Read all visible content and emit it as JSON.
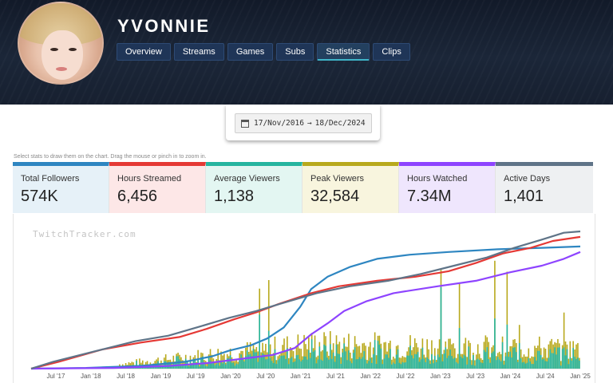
{
  "channel": {
    "name": "YVONNIE"
  },
  "tabs": [
    {
      "label": "Overview"
    },
    {
      "label": "Streams"
    },
    {
      "label": "Games"
    },
    {
      "label": "Subs"
    },
    {
      "label": "Statistics",
      "active": true
    },
    {
      "label": "Clips"
    }
  ],
  "date_range": {
    "start": "17/Nov/2016",
    "arrow": "→",
    "end": "18/Dec/2024"
  },
  "hint": "Select stats to draw them on the chart. Drag the mouse or pinch in to zoom in.",
  "stats": [
    {
      "label": "Total Followers",
      "value": "574K",
      "color": "#2e86c1",
      "bg": "#e6f1f8"
    },
    {
      "label": "Hours Streamed",
      "value": "6,456",
      "color": "#e53935",
      "bg": "#fde7e7"
    },
    {
      "label": "Average Viewers",
      "value": "1,138",
      "color": "#26b5a0",
      "bg": "#e3f6f2"
    },
    {
      "label": "Peak Viewers",
      "value": "32,584",
      "color": "#b8a91d",
      "bg": "#f8f5de"
    },
    {
      "label": "Hours Watched",
      "value": "7.34M",
      "color": "#8e44ff",
      "bg": "#efe6fd"
    },
    {
      "label": "Active Days",
      "value": "1,401",
      "color": "#5f7488",
      "bg": "#eef0f2"
    }
  ],
  "chart": {
    "watermark": "TwitchTracker.com",
    "x_ticks": [
      "Jul '17",
      "Jan '18",
      "Jul '18",
      "Jan '19",
      "Jul '19",
      "Jan '20",
      "Jul '20",
      "Jan '21",
      "Jul '21",
      "Jan '22",
      "Jul '22",
      "Jan '23",
      "Jul '23",
      "Jan '24",
      "Jul '24",
      "Jan '25"
    ]
  },
  "chart_data": {
    "type": "line",
    "x_range": [
      "2016-11-17",
      "2024-12-18"
    ],
    "x_ticks": [
      "Jul '17",
      "Jan '18",
      "Jul '18",
      "Jan '19",
      "Jul '19",
      "Jan '20",
      "Jul '20",
      "Jan '21",
      "Jul '21",
      "Jan '22",
      "Jul '22",
      "Jan '23",
      "Jul '23",
      "Jan '24",
      "Jul '24",
      "Jan '25"
    ],
    "series": [
      {
        "name": "Total Followers",
        "color": "#2e86c1",
        "kind": "cumulative",
        "values": [
          [
            0,
            0
          ],
          [
            0.1,
            0.005
          ],
          [
            0.2,
            0.02
          ],
          [
            0.28,
            0.05
          ],
          [
            0.33,
            0.09
          ],
          [
            0.36,
            0.13
          ],
          [
            0.4,
            0.17
          ],
          [
            0.43,
            0.22
          ],
          [
            0.46,
            0.3
          ],
          [
            0.49,
            0.45
          ],
          [
            0.51,
            0.58
          ],
          [
            0.54,
            0.67
          ],
          [
            0.58,
            0.74
          ],
          [
            0.63,
            0.8
          ],
          [
            0.69,
            0.83
          ],
          [
            0.76,
            0.85
          ],
          [
            0.85,
            0.87
          ],
          [
            0.93,
            0.88
          ],
          [
            1,
            0.89
          ]
        ]
      },
      {
        "name": "Hours Streamed",
        "color": "#e53935",
        "kind": "cumulative",
        "values": [
          [
            0,
            0
          ],
          [
            0.05,
            0.05
          ],
          [
            0.13,
            0.14
          ],
          [
            0.2,
            0.19
          ],
          [
            0.27,
            0.23
          ],
          [
            0.32,
            0.29
          ],
          [
            0.37,
            0.36
          ],
          [
            0.41,
            0.41
          ],
          [
            0.45,
            0.47
          ],
          [
            0.51,
            0.55
          ],
          [
            0.56,
            0.6
          ],
          [
            0.63,
            0.64
          ],
          [
            0.7,
            0.67
          ],
          [
            0.76,
            0.71
          ],
          [
            0.81,
            0.77
          ],
          [
            0.86,
            0.84
          ],
          [
            0.91,
            0.88
          ],
          [
            0.95,
            0.93
          ],
          [
            1,
            0.96
          ]
        ]
      },
      {
        "name": "Hours Watched",
        "color": "#8e44ff",
        "kind": "cumulative",
        "values": [
          [
            0,
            0
          ],
          [
            0.15,
            0.005
          ],
          [
            0.25,
            0.02
          ],
          [
            0.32,
            0.04
          ],
          [
            0.38,
            0.07
          ],
          [
            0.44,
            0.1
          ],
          [
            0.48,
            0.15
          ],
          [
            0.51,
            0.25
          ],
          [
            0.54,
            0.33
          ],
          [
            0.57,
            0.42
          ],
          [
            0.61,
            0.49
          ],
          [
            0.66,
            0.55
          ],
          [
            0.74,
            0.6
          ],
          [
            0.81,
            0.64
          ],
          [
            0.87,
            0.7
          ],
          [
            0.93,
            0.75
          ],
          [
            0.97,
            0.8
          ],
          [
            1,
            0.85
          ]
        ]
      },
      {
        "name": "Active Days",
        "color": "#5f7488",
        "kind": "cumulative",
        "values": [
          [
            0,
            0
          ],
          [
            0.04,
            0.05
          ],
          [
            0.12,
            0.13
          ],
          [
            0.19,
            0.2
          ],
          [
            0.25,
            0.24
          ],
          [
            0.31,
            0.31
          ],
          [
            0.36,
            0.37
          ],
          [
            0.41,
            0.42
          ],
          [
            0.46,
            0.48
          ],
          [
            0.52,
            0.55
          ],
          [
            0.58,
            0.6
          ],
          [
            0.65,
            0.64
          ],
          [
            0.71,
            0.69
          ],
          [
            0.77,
            0.75
          ],
          [
            0.83,
            0.81
          ],
          [
            0.88,
            0.88
          ],
          [
            0.93,
            0.94
          ],
          [
            0.97,
            0.99
          ],
          [
            1,
            1.0
          ]
        ]
      },
      {
        "name": "Peak Viewers",
        "color": "#b8a91d",
        "kind": "bars",
        "relative_bars": true
      },
      {
        "name": "Average Viewers",
        "color": "#26b5a0",
        "kind": "bars",
        "relative_bars": true
      }
    ]
  }
}
